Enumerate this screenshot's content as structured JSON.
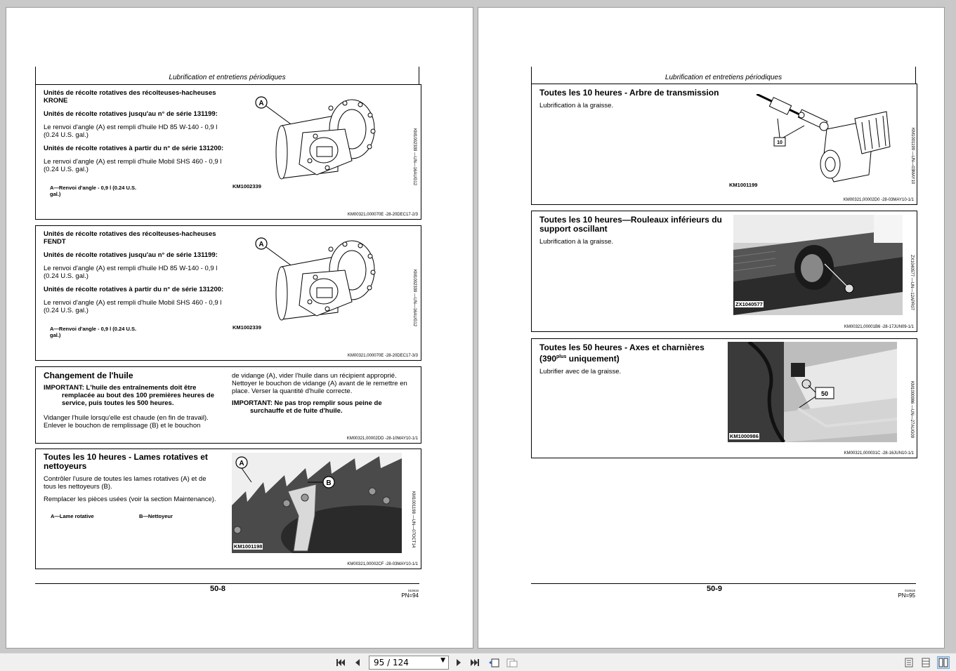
{
  "header": {
    "left": "Lubrification et entretiens périodiques",
    "right": "Lubrification et entretiens périodiques"
  },
  "left_page": {
    "sec1": {
      "title": "Unités de récolte rotatives des récolteuses-hacheuses KRONE",
      "sub1": "Unités de récolte rotatives jusqu'au n° de série 131199:",
      "txt1": "Le renvoi d'angle (A) est rempli d'huile HD 85 W-140 - 0,9 l (0.24 U.S. gal.)",
      "sub2": "Unités de récolte rotatives à partir du n° de série 131200:",
      "txt2": "Le renvoi d'angle (A) est rempli d'huile Mobil SHS 460 - 0,9 l (0.24 U.S. gal.)",
      "legend": "A—Renvoi d'angle - 0,9 l (0.24 U.S. gal.)",
      "img_code": "KM1002339",
      "vcode": "KM1002339 —UN—16AUG12",
      "callout": "A",
      "ref": "KM00321,000070E -28-20DEC17-2/3"
    },
    "sec2": {
      "title": "Unités de récolte rotatives des récolteuses-hacheuses FENDT",
      "sub1": "Unités de récolte rotatives jusqu'au n° de série 131199:",
      "txt1": "Le renvoi d'angle (A) est rempli d'huile HD 85 W-140 - 0,9 l (0.24 U.S. gal.)",
      "sub2": "Unités de récolte rotatives à partir du n° de série 131200:",
      "txt2": "Le renvoi d'angle (A) est rempli d'huile Mobil SHS 460 - 0,9 l (0.24 U.S. gal.)",
      "legend": "A—Renvoi d'angle - 0,9 l (0.24 U.S. gal.)",
      "img_code": "KM1002339",
      "vcode": "KM1002339 —UN—16AUG12",
      "callout": "A",
      "ref": "KM00321,000070E -28-20DEC17-3/3"
    },
    "sec3": {
      "title": "Changement de l'huile",
      "important1": "IMPORTANT: L'huile des entraînements doit être remplacée au bout des 100 premières heures de service, puis toutes les 500 heures.",
      "txt1": "Vidanger l'huile lorsqu'elle est chaude (en fin de travail). Enlever le bouchon de remplissage (B) et le bouchon",
      "txt2": "de vidange (A), vider l'huile dans un récipient approprié. Nettoyer le bouchon de vidange (A) avant de le remettre en place. Verser la quantité d'huile correcte.",
      "important2": "IMPORTANT: Ne pas trop remplir sous peine de surchauffe et de fuite d'huile.",
      "ref": "KM00321,00002DD -28-10MAY10-1/1"
    },
    "sec4": {
      "title": "Toutes les 10 heures - Lames rotatives et nettoyeurs",
      "txt1": "Contrôler l'usure de toutes les lames rotatives (A) et de tous les nettoyeurs (B).",
      "txt2": "Remplacer les pièces usées (voir la section Maintenance).",
      "legend_a": "A—Lame rotative",
      "legend_b": "B—Nettoyeur",
      "img_code": "KM1001198",
      "vcode": "KM1001198 —UN—07OCT14",
      "callout_a": "A",
      "callout_b": "B",
      "ref": "KM00321,00002CF -28-03MAY10-1/1"
    },
    "page_number": "50-8",
    "pn_code": "010616",
    "pn": "PN=94"
  },
  "right_page": {
    "sec1": {
      "title": "Toutes les 10 heures - Arbre de transmission",
      "txt": "Lubrification à la graisse.",
      "img_code": "KM1001199",
      "vcode": "KM1001199 —UN—03MAY10",
      "icon_label": "10",
      "ref": "KM00321,00002D0 -28-03MAY10-1/1"
    },
    "sec2": {
      "title": "Toutes les 10 heures—Rouleaux inférieurs du support oscillant",
      "txt": "Lubrification à la graisse.",
      "img_code": "ZX1040577",
      "vcode": "ZX1040577 —UN—12APR07",
      "ref": "KM00321,00001B6 -28-17JUN09-1/1"
    },
    "sec3": {
      "title_a": "Toutes les 50 heures - Axes et charnières (390",
      "title_sup": "plus",
      "title_b": " uniquement)",
      "txt": "Lubrifier avec de la graisse.",
      "img_code": "KM1000986",
      "vcode": "KM1000986 —UN—27AUG09",
      "icon_label": "50",
      "ref": "KM00321,000031C -28-16JUN10-1/1"
    },
    "page_number": "50-9",
    "pn_code": "010616",
    "pn": "PN=95"
  },
  "toolbar": {
    "page_field": "95 / 124"
  }
}
